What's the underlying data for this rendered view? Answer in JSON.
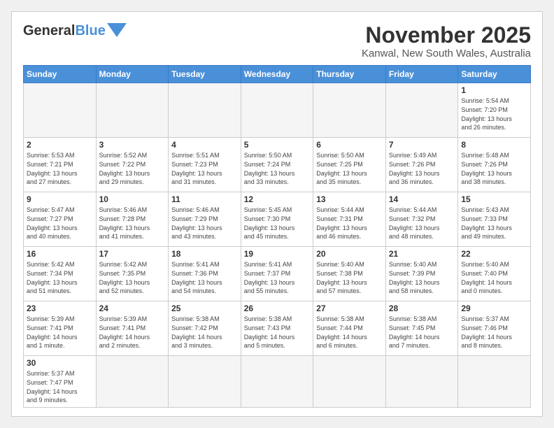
{
  "header": {
    "logo_general": "General",
    "logo_blue": "Blue",
    "month_title": "November 2025",
    "location": "Kanwal, New South Wales, Australia"
  },
  "weekdays": [
    "Sunday",
    "Monday",
    "Tuesday",
    "Wednesday",
    "Thursday",
    "Friday",
    "Saturday"
  ],
  "days": {
    "1": {
      "sunrise": "5:54 AM",
      "sunset": "7:20 PM",
      "daylight": "13 hours and 26 minutes."
    },
    "2": {
      "sunrise": "5:53 AM",
      "sunset": "7:21 PM",
      "daylight": "13 hours and 27 minutes."
    },
    "3": {
      "sunrise": "5:52 AM",
      "sunset": "7:22 PM",
      "daylight": "13 hours and 29 minutes."
    },
    "4": {
      "sunrise": "5:51 AM",
      "sunset": "7:23 PM",
      "daylight": "13 hours and 31 minutes."
    },
    "5": {
      "sunrise": "5:50 AM",
      "sunset": "7:24 PM",
      "daylight": "13 hours and 33 minutes."
    },
    "6": {
      "sunrise": "5:50 AM",
      "sunset": "7:25 PM",
      "daylight": "13 hours and 35 minutes."
    },
    "7": {
      "sunrise": "5:49 AM",
      "sunset": "7:26 PM",
      "daylight": "13 hours and 36 minutes."
    },
    "8": {
      "sunrise": "5:48 AM",
      "sunset": "7:26 PM",
      "daylight": "13 hours and 38 minutes."
    },
    "9": {
      "sunrise": "5:47 AM",
      "sunset": "7:27 PM",
      "daylight": "13 hours and 40 minutes."
    },
    "10": {
      "sunrise": "5:46 AM",
      "sunset": "7:28 PM",
      "daylight": "13 hours and 41 minutes."
    },
    "11": {
      "sunrise": "5:46 AM",
      "sunset": "7:29 PM",
      "daylight": "13 hours and 43 minutes."
    },
    "12": {
      "sunrise": "5:45 AM",
      "sunset": "7:30 PM",
      "daylight": "13 hours and 45 minutes."
    },
    "13": {
      "sunrise": "5:44 AM",
      "sunset": "7:31 PM",
      "daylight": "13 hours and 46 minutes."
    },
    "14": {
      "sunrise": "5:44 AM",
      "sunset": "7:32 PM",
      "daylight": "13 hours and 48 minutes."
    },
    "15": {
      "sunrise": "5:43 AM",
      "sunset": "7:33 PM",
      "daylight": "13 hours and 49 minutes."
    },
    "16": {
      "sunrise": "5:42 AM",
      "sunset": "7:34 PM",
      "daylight": "13 hours and 51 minutes."
    },
    "17": {
      "sunrise": "5:42 AM",
      "sunset": "7:35 PM",
      "daylight": "13 hours and 52 minutes."
    },
    "18": {
      "sunrise": "5:41 AM",
      "sunset": "7:36 PM",
      "daylight": "13 hours and 54 minutes."
    },
    "19": {
      "sunrise": "5:41 AM",
      "sunset": "7:37 PM",
      "daylight": "13 hours and 55 minutes."
    },
    "20": {
      "sunrise": "5:40 AM",
      "sunset": "7:38 PM",
      "daylight": "13 hours and 57 minutes."
    },
    "21": {
      "sunrise": "5:40 AM",
      "sunset": "7:39 PM",
      "daylight": "13 hours and 58 minutes."
    },
    "22": {
      "sunrise": "5:40 AM",
      "sunset": "7:40 PM",
      "daylight": "14 hours and 0 minutes."
    },
    "23": {
      "sunrise": "5:39 AM",
      "sunset": "7:41 PM",
      "daylight": "14 hours and 1 minute."
    },
    "24": {
      "sunrise": "5:39 AM",
      "sunset": "7:41 PM",
      "daylight": "14 hours and 2 minutes."
    },
    "25": {
      "sunrise": "5:38 AM",
      "sunset": "7:42 PM",
      "daylight": "14 hours and 3 minutes."
    },
    "26": {
      "sunrise": "5:38 AM",
      "sunset": "7:43 PM",
      "daylight": "14 hours and 5 minutes."
    },
    "27": {
      "sunrise": "5:38 AM",
      "sunset": "7:44 PM",
      "daylight": "14 hours and 6 minutes."
    },
    "28": {
      "sunrise": "5:38 AM",
      "sunset": "7:45 PM",
      "daylight": "14 hours and 7 minutes."
    },
    "29": {
      "sunrise": "5:37 AM",
      "sunset": "7:46 PM",
      "daylight": "14 hours and 8 minutes."
    },
    "30": {
      "sunrise": "5:37 AM",
      "sunset": "7:47 PM",
      "daylight": "14 hours and 9 minutes."
    }
  }
}
